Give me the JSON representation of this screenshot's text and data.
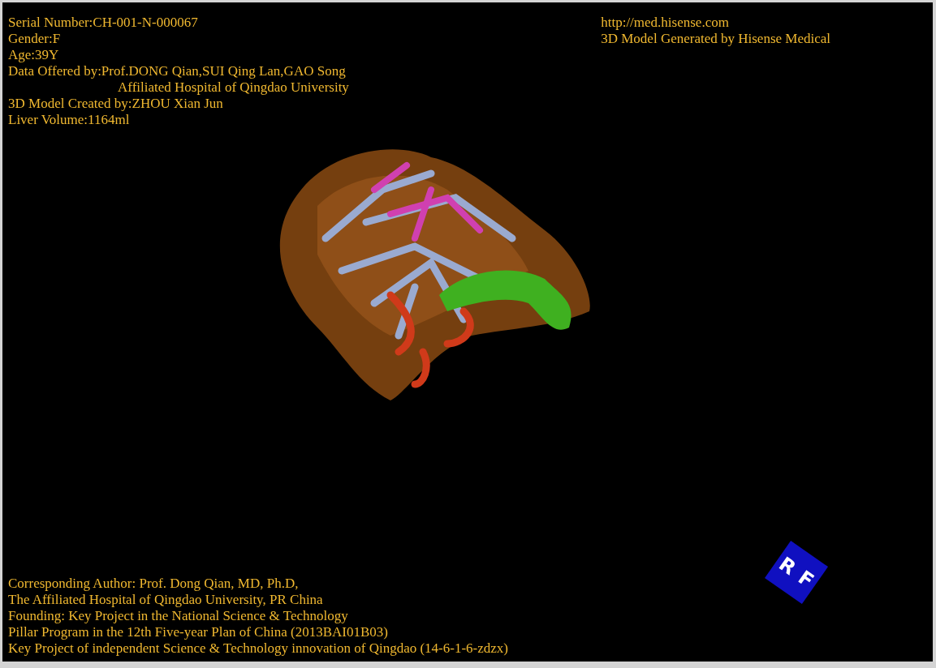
{
  "patient_info": [
    {
      "text": "Serial Number:CH-001-N-000067",
      "kind": "line"
    },
    {
      "text": "Gender:F",
      "kind": "line"
    },
    {
      "text": "Age:39Y",
      "kind": "line"
    },
    {
      "text": "Data Offered by:Prof.DONG Qian,SUI Qing Lan,GAO Song",
      "kind": "line"
    },
    {
      "text": "Affiliated Hospital of Qingdao University",
      "kind": "continuation"
    },
    {
      "text": "3D Model Created by:ZHOU Xian Jun",
      "kind": "line"
    },
    {
      "text": "Liver Volume:1164ml",
      "kind": "line"
    }
  ],
  "credits_top": [
    "http://med.hisense.com",
    "3D Model Generated by Hisense Medical"
  ],
  "credits_bottom": [
    "Corresponding Author: Prof. Dong Qian, MD, Ph.D,",
    "The Affiliated Hospital of Qingdao University, PR China",
    "Founding: Key Project in the National Science & Technology",
    "Pillar Program in the 12th Five-year Plan of China (2013BAI01B03)",
    "Key Project of independent Science & Technology innovation of Qingdao (14-6-1-6-zdzx)"
  ],
  "orientation_cube": {
    "faces": [
      "R",
      "F"
    ]
  }
}
